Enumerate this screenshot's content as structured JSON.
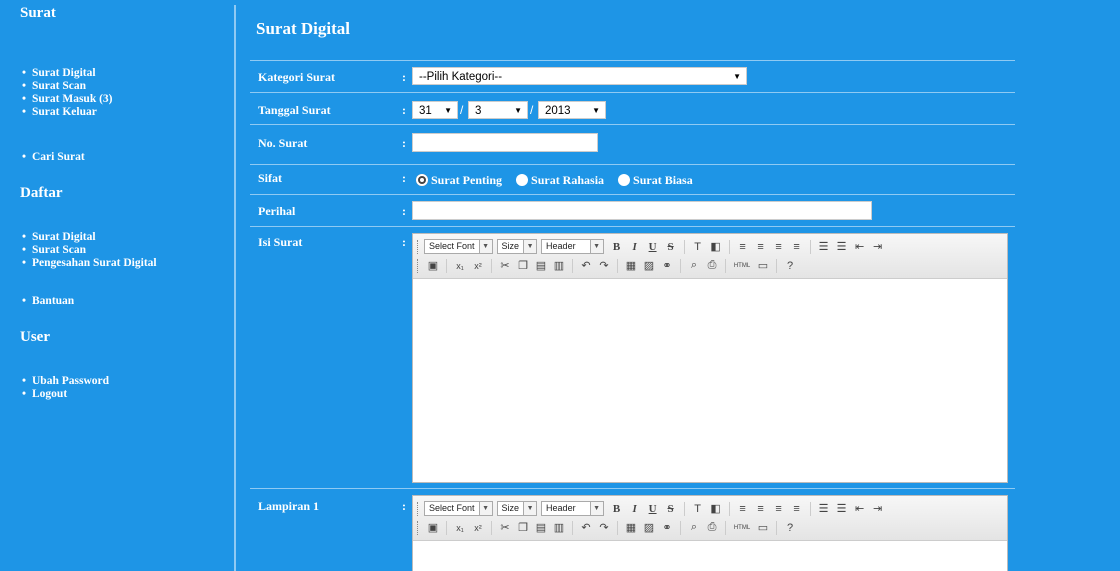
{
  "sidebar": {
    "sections": [
      {
        "title": "Surat",
        "items": [
          "Surat Digital",
          "Surat Scan",
          "Surat Masuk (3)",
          "Surat Keluar"
        ],
        "extra": [
          "Cari Surat"
        ]
      },
      {
        "title": "Daftar",
        "items": [
          "Surat Digital",
          "Surat Scan",
          "Pengesahan Surat Digital"
        ],
        "extra": [
          "Bantuan"
        ]
      },
      {
        "title": "User",
        "items": [
          "Ubah Password",
          "Logout"
        ]
      }
    ]
  },
  "main": {
    "title": "Surat Digital",
    "colon": ":",
    "fields": {
      "kategori": {
        "label": "Kategori Surat",
        "value": "--Pilih Kategori--"
      },
      "tanggal": {
        "label": "Tanggal Surat",
        "day": "31",
        "month": "3",
        "year": "2013",
        "sep": "/"
      },
      "nomor": {
        "label": "No. Surat",
        "value": ""
      },
      "sifat": {
        "label": "Sifat",
        "options": [
          "Surat Penting",
          "Surat Rahasia",
          "Surat Biasa"
        ],
        "selected": "Surat Penting"
      },
      "perihal": {
        "label": "Perihal",
        "value": ""
      },
      "isi": {
        "label": "Isi Surat"
      },
      "lampiran": {
        "label": "Lampiran 1"
      }
    },
    "editor_toolbar": {
      "font_select": "Select Font",
      "size_select": "Size",
      "header_select": "Header",
      "bold": "B",
      "italic": "I",
      "underline": "U",
      "strike": "S"
    }
  }
}
